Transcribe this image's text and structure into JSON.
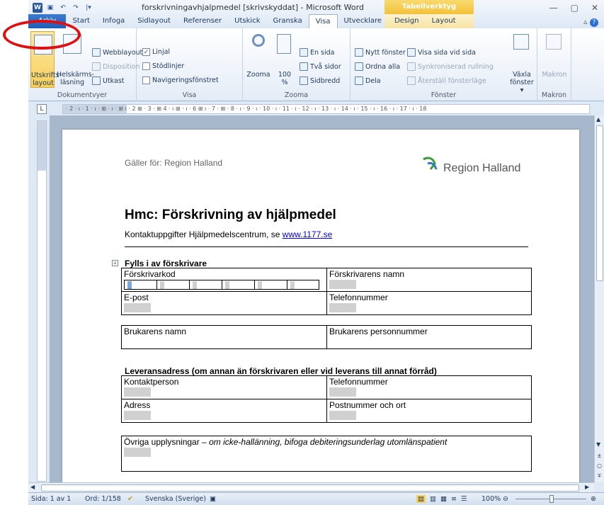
{
  "window": {
    "title": "forskrivningavhjalpmedel [skrivskyddat] - Microsoft Word",
    "context_tab_header": "Tabellverktyg"
  },
  "tabs": [
    "Arkiv",
    "Start",
    "Infoga",
    "Sidlayout",
    "Referenser",
    "Utskick",
    "Granska",
    "Visa",
    "Utvecklare",
    "Design",
    "Layout"
  ],
  "ribbon": {
    "dokumentvyer": {
      "label": "Dokumentvyer",
      "utskriftslayout_1": "Utskrifts-",
      "utskriftslayout_2": "layout",
      "helskarm_1": "Helskärms-",
      "helskarm_2": "läsning",
      "webblayout": "Webblayout",
      "disposition": "Disposition",
      "utkast": "Utkast"
    },
    "visa": {
      "label": "Visa",
      "linjal": "Linjal",
      "stodlinjer": "Stödlinjer",
      "navigering": "Navigeringsfönstret"
    },
    "zoom": {
      "label": "Zooma",
      "zooma": "Zooma",
      "pct_1": "100",
      "pct_2": "%",
      "en_sida": "En sida",
      "tva_sidor": "Två sidor",
      "sidbredd": "Sidbredd"
    },
    "fonster": {
      "label": "Fönster",
      "nytt": "Nytt fönster",
      "ordna": "Ordna alla",
      "dela": "Dela",
      "visa_sida": "Visa sida vid sida",
      "synk": "Synkroniserad rullning",
      "aterstall": "Återställ fönsterläge",
      "vaxla_1": "Växla",
      "vaxla_2": "fönster ▾"
    },
    "makron": {
      "label": "Makron",
      "btn": "Makron"
    }
  },
  "ruler_text": "· 2 · ı · 1 · ı · ⊞ · ı · ⊞ ı · 2 ⊞ · 3 · ⊞ 4 · ı ⊞ · ı · 6 ⊞ ı · 7 · ⊞ · 8 · ı · 9 · ı · 10 · ı · 11 · ı · 12 · ı · 13 · ı · 14 · ı · 15 · ı · 16 · ı · 17 · ı · 18",
  "document": {
    "header_left": "Gäller för: Region Halland",
    "logo_text": "Region Halland",
    "heading": "Hmc: Förskrivning av hjälpmedel",
    "contact_prefix": "Kontaktuppgifter Hjälpmedelscentrum, se ",
    "contact_link": "www.1177.se",
    "section1": "Fylls i av förskrivare",
    "forskrivarkod": "Förskrivarkod",
    "forskrivarens_namn": "Förskrivarens namn",
    "epost": "E-post",
    "telefonnummer": "Telefonnummer",
    "brukarens_namn": "Brukarens namn",
    "brukarens_pnr": "Brukarens personnummer",
    "section2": "Leveransadress (om annan än förskrivaren eller vid leverans till annat förråd)",
    "kontaktperson": "Kontaktperson",
    "telefonnummer2": "Telefonnummer",
    "adress": "Adress",
    "postnummer": "Postnummer och ort",
    "ovriga_prefix": "Övriga upplysningar – ",
    "ovriga_italic": "om icke-hallänning, bifoga debiteringsunderlag utomlänspatient"
  },
  "status": {
    "sida": "Sida: 1 av 1",
    "ord": "Ord: 1/158",
    "sprak": "Svenska (Sverige)",
    "zoom": "100%"
  }
}
